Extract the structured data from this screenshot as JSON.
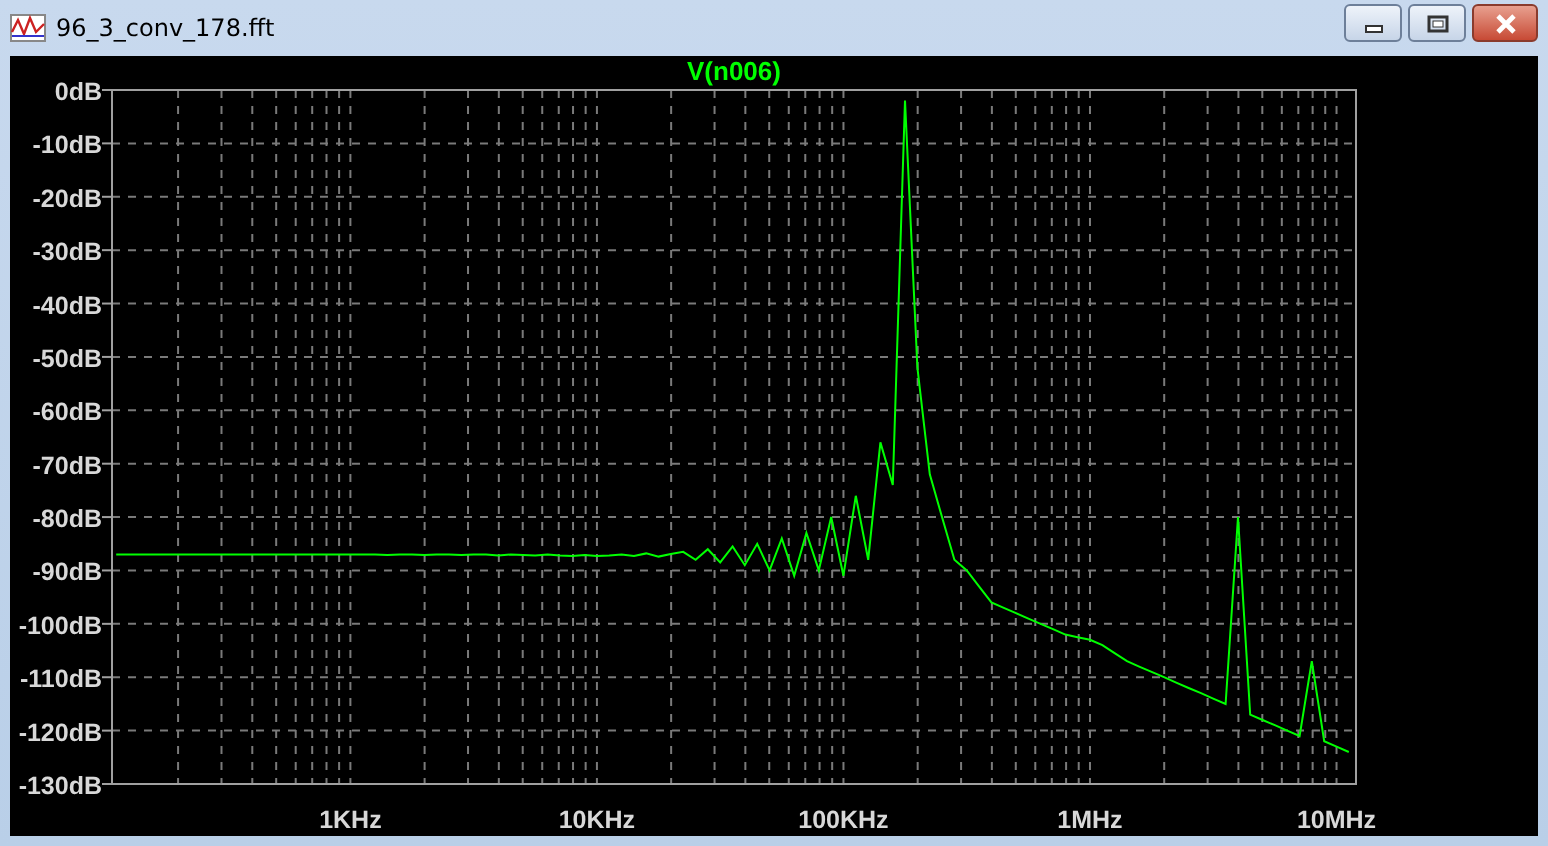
{
  "window": {
    "title": "96_3_conv_178.fft"
  },
  "plot": {
    "chart_data": {
      "type": "line",
      "grid": true,
      "categories": [
        null,
        null,
        null,
        null,
        null,
        null,
        null,
        null,
        null,
        null,
        null,
        null,
        null,
        null,
        null,
        null,
        null,
        null,
        null,
        "1KHz",
        null,
        null,
        null,
        null,
        null,
        null,
        null,
        null,
        null,
        null,
        null,
        null,
        null,
        null,
        null,
        null,
        null,
        null,
        null,
        "10KHz",
        null,
        null,
        null,
        null,
        null,
        null,
        null,
        null,
        null,
        null,
        null,
        null,
        null,
        null,
        null,
        null,
        null,
        null,
        null,
        "100KHz",
        null,
        null,
        null,
        null,
        null,
        null,
        null,
        null,
        null,
        null,
        null,
        null,
        null,
        null,
        null,
        null,
        null,
        null,
        null,
        "1MHz",
        null,
        null,
        null,
        null,
        null,
        null,
        null,
        null,
        null,
        null,
        null,
        null,
        null,
        null,
        null,
        null,
        null,
        null,
        null,
        "10MHz",
        null
      ],
      "series": [
        {
          "name": "V(n006)",
          "color": "#00ff00",
          "values": [
            -87,
            -87,
            -87,
            -87,
            -87,
            -87,
            -87,
            -87,
            -87,
            -87,
            -87,
            -87,
            -87,
            -87,
            -87,
            -87,
            -87,
            -87,
            -87,
            -87,
            -87,
            -87,
            -87.1,
            -87,
            -87,
            -87.1,
            -87,
            -87,
            -87.1,
            -87,
            -87,
            -87.2,
            -87,
            -87.1,
            -87.2,
            -87,
            -87.2,
            -87.3,
            -87.1,
            -87.3,
            -87.2,
            -87,
            -87.3,
            -86.8,
            -87.4,
            -86.9,
            -86.5,
            -88,
            -86,
            -88.5,
            -85.5,
            -89,
            -85,
            -90,
            -84,
            -91,
            -83,
            -90,
            -80,
            -91,
            -76,
            -88,
            -66,
            -74,
            -2,
            -52,
            -72,
            -80,
            -88,
            -90,
            -93,
            -96,
            -97,
            -98,
            -99,
            -100,
            -101,
            -102,
            -102.5,
            -103,
            -104,
            -105.5,
            -107,
            -108,
            -109,
            -110,
            -111,
            -112,
            -113,
            -114,
            -115,
            -80,
            -117,
            -118,
            -119,
            -120,
            -121,
            -107,
            -122,
            -123,
            -124
          ]
        }
      ],
      "ylim": [
        -130,
        0
      ],
      "yticks": [
        {
          "value": 0,
          "label": "0dB"
        },
        {
          "value": -10,
          "label": "-10dB"
        },
        {
          "value": -20,
          "label": "-20dB"
        },
        {
          "value": -30,
          "label": "-30dB"
        },
        {
          "value": -40,
          "label": "-40dB"
        },
        {
          "value": -50,
          "label": "-50dB"
        },
        {
          "value": -60,
          "label": "-60dB"
        },
        {
          "value": -70,
          "label": "-70dB"
        },
        {
          "value": -80,
          "label": "-80dB"
        },
        {
          "value": -90,
          "label": "-90dB"
        },
        {
          "value": -100,
          "label": "-100dB"
        },
        {
          "value": -110,
          "label": "-110dB"
        },
        {
          "value": -120,
          "label": "-120dB"
        },
        {
          "value": -130,
          "label": "-130dB"
        }
      ]
    }
  }
}
